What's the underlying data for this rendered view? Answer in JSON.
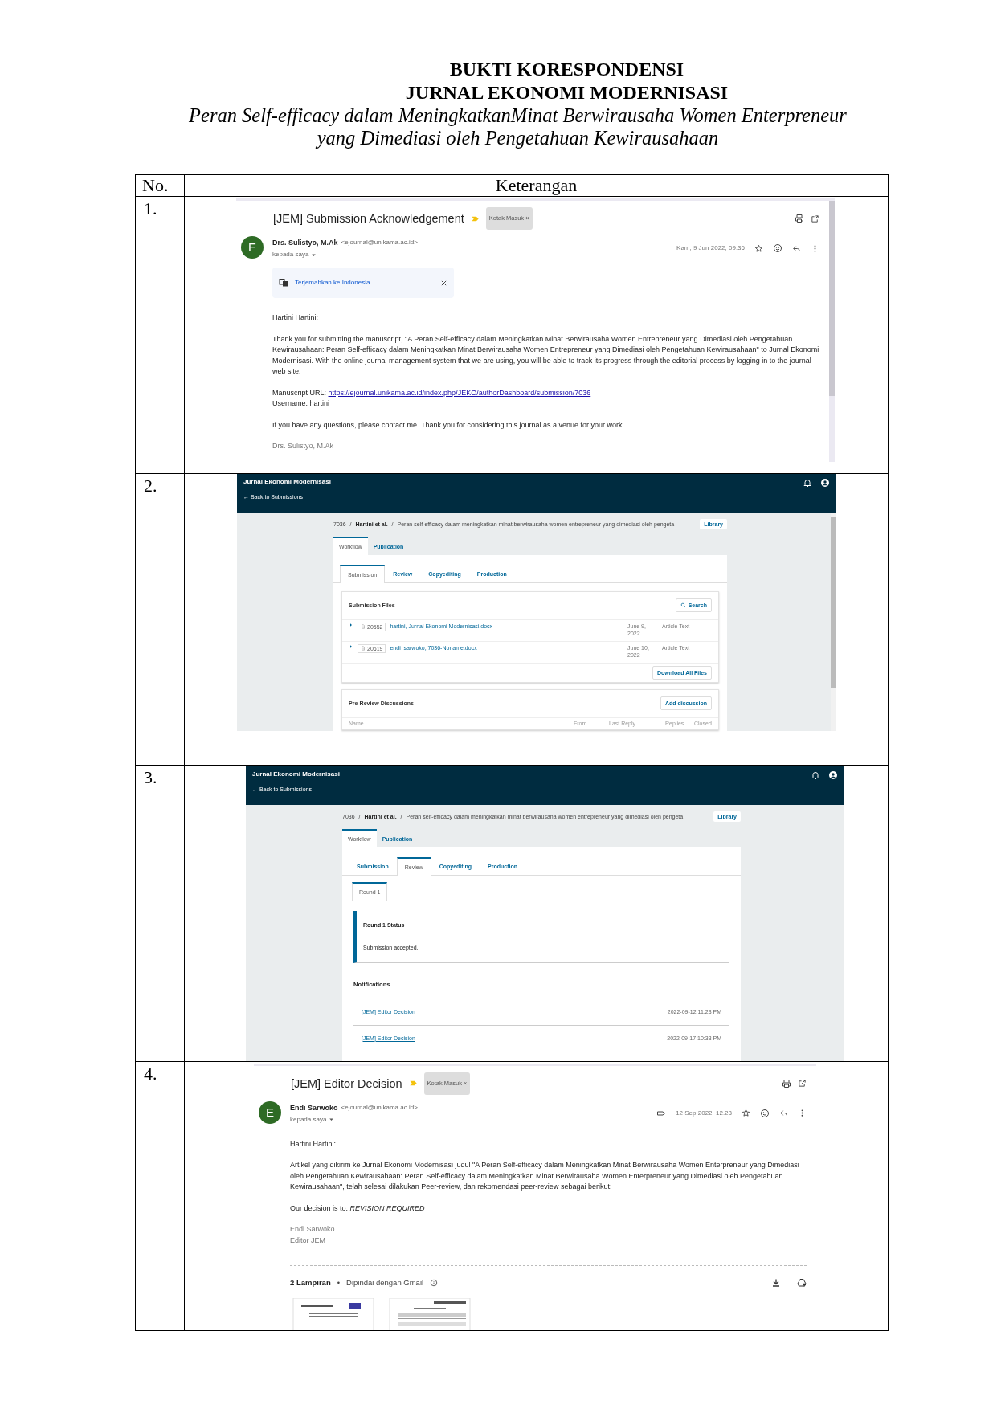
{
  "document": {
    "title_lines": [
      "BUKTI KORESPONDENSI",
      "JURNAL EKONOMI MODERNISASI"
    ],
    "subtitle_lines": [
      "Peran Self-efficacy dalam MeningkatkanMinat Berwirausaha Women Enterpreneur",
      "yang Dimediasi oleh Pengetahuan Kewirausahaan"
    ]
  },
  "table": {
    "columns": [
      "No.",
      "Keterangan"
    ],
    "rows": [
      {
        "number": "1.",
        "screenshot": {
          "kind": "email",
          "subject": "[JEM] Submission Acknowledgement",
          "label_chip": "Kotak Masuk ×",
          "avatar_letter": "E",
          "sender": "Drs. Sulistyo, M.Ak",
          "address": "<ejournal@unikama.ac.id>",
          "recipient": "kepada saya",
          "date": "Kam, 9 Jun 2022, 09.36",
          "translate": "Terjemahkan ke Indonesia",
          "body": [
            {
              "kind": "paragraph",
              "text": "Hartini Hartini:"
            },
            {
              "kind": "paragraph",
              "text": "Thank you for submitting the manuscript, \"A Peran Self-efficacy dalam Meningkatkan Minat Berwirausaha Women Entrepreneur yang Dimediasi oleh Pengetahuan Kewirausahaan: Peran Self-efficacy dalam Meningkatkan Minat Berwirausaha Women Entrepreneur yang Dimediasi oleh Pengetahuan Kewirausahaan\" to Jurnal Ekonomi Modernisasi. With the online journal management system that we are using, you will be able to track its progress through the editorial process by logging in to the journal web site."
            },
            {
              "kind": "link_line",
              "label": "Manuscript URL: ",
              "link": "https://ejournal.unikama.ac.id/index.php/JEKO/authorDashboard/submission/7036"
            },
            {
              "kind": "paragraph",
              "text": "Username: hartini"
            },
            {
              "kind": "paragraph",
              "text": "If you have any questions, please contact me. Thank you for considering this journal as a venue for your work."
            },
            {
              "kind": "signature",
              "lines": [
                "Drs. Sulistyo, M.Ak"
              ]
            }
          ]
        }
      },
      {
        "number": "2.",
        "screenshot": {
          "kind": "ojs",
          "site": "Jurnal Ekonomi Modernisasi",
          "back": "← Back to Submissions",
          "separator": "/",
          "breadcrumb": [
            {
              "text": "7036",
              "bold": false
            },
            {
              "text": "Hartini et al.",
              "bold": true
            },
            {
              "text": "Peran self-efficacy dalam meningkatkan minat berwirausaha women entrepreneur yang dimediasi oleh pengeta",
              "bold": false
            }
          ],
          "library": "Library",
          "tabs": [
            {
              "label": "Workflow",
              "selected": true
            },
            {
              "label": "Publication",
              "selected": false
            }
          ],
          "stages": [
            {
              "label": "Submission",
              "selected": true
            },
            {
              "label": "Review",
              "selected": false
            },
            {
              "label": "Copyediting",
              "selected": false
            },
            {
              "label": "Production",
              "selected": false
            }
          ],
          "content": {
            "kind": "files",
            "title": "Submission Files",
            "search": "Search",
            "files": [
              {
                "id": "20552",
                "name": "hartini, Jurnal Ekonomi Modernisasi.docx",
                "date": "June 9, 2022",
                "type": "Article Text"
              },
              {
                "id": "20619",
                "name": "endi_sarwoko, 7036-Noname.docx",
                "date": "June 10, 2022",
                "type": "Article Text"
              }
            ],
            "download": "Download All Files",
            "discussions_title": "Pre-Review Discussions",
            "add_discussion": "Add discussion",
            "discussion_columns": [
              "Name",
              "From",
              "Last Reply",
              "Replies",
              "Closed"
            ]
          }
        }
      },
      {
        "number": "3.",
        "screenshot": {
          "kind": "ojs",
          "site": "Jurnal Ekonomi Modernisasi",
          "back": "← Back to Submissions",
          "separator": "/",
          "breadcrumb": [
            {
              "text": "7036",
              "bold": false
            },
            {
              "text": "Hartini et al.",
              "bold": true
            },
            {
              "text": "Peran self-efficacy dalam meningkatkan minat berwirausaha women entrepreneur yang dimediasi oleh pengeta",
              "bold": false
            }
          ],
          "library": "Library",
          "tabs": [
            {
              "label": "Workflow",
              "selected": true
            },
            {
              "label": "Publication",
              "selected": false
            }
          ],
          "stages": [
            {
              "label": "Submission",
              "selected": false
            },
            {
              "label": "Review",
              "selected": true
            },
            {
              "label": "Copyediting",
              "selected": false
            },
            {
              "label": "Production",
              "selected": false
            }
          ],
          "content": {
            "kind": "review",
            "rounds": [
              {
                "label": "Round 1",
                "selected": true
              }
            ],
            "status_title": "Round 1 Status",
            "status": "Submission accepted.",
            "notifications_title": "Notifications",
            "notifications": [
              {
                "text": "[JEM] Editor Decision",
                "date": "2022-09-12 11:23 PM"
              },
              {
                "text": "[JEM] Editor Decision",
                "date": "2022-09-17 10:33 PM"
              }
            ]
          }
        }
      },
      {
        "number": "4.",
        "screenshot": {
          "kind": "email",
          "subject": "[JEM] Editor Decision",
          "label_chip": "Kotak Masuk ×",
          "avatar_letter": "E",
          "sender": "Endi Sarwoko",
          "address": "<ejournal@unikama.ac.id>",
          "recipient": "kepada saya",
          "date": "12 Sep 2022, 12.23",
          "body": [
            {
              "kind": "paragraph",
              "text": "Hartini Hartini:"
            },
            {
              "kind": "paragraph",
              "text": "Artikel yang dikirim ke Jurnal Ekonomi Modernisasi judul \"A Peran Self-efficacy dalam Meningkatkan Minat Berwirausaha Women Enterpreneur yang Dimediasi oleh Pengetahuan Kewirausahaan: Peran Self-efficacy dalam Meningkatkan Minat Berwirausaha Women Enterpreneur yang Dimediasi oleh Pengetahuan Kewirausahaan\", telah selesai dilakukan Peer-review, dan rekomendasi peer-review sebagai berikut:"
            },
            {
              "kind": "paragraph",
              "text": "Our decision is to: *REVISION REQUIRED*"
            },
            {
              "kind": "signature",
              "lines": [
                "Endi Sarwoko",
                "Editor JEM"
              ]
            }
          ],
          "attachments": {
            "count": "2 Lampiran",
            "dot": "•",
            "scan": "Dipindai dengan Gmail",
            "items": [
              {
                "kind": "document"
              },
              {
                "kind": "document"
              }
            ]
          }
        }
      }
    ]
  }
}
